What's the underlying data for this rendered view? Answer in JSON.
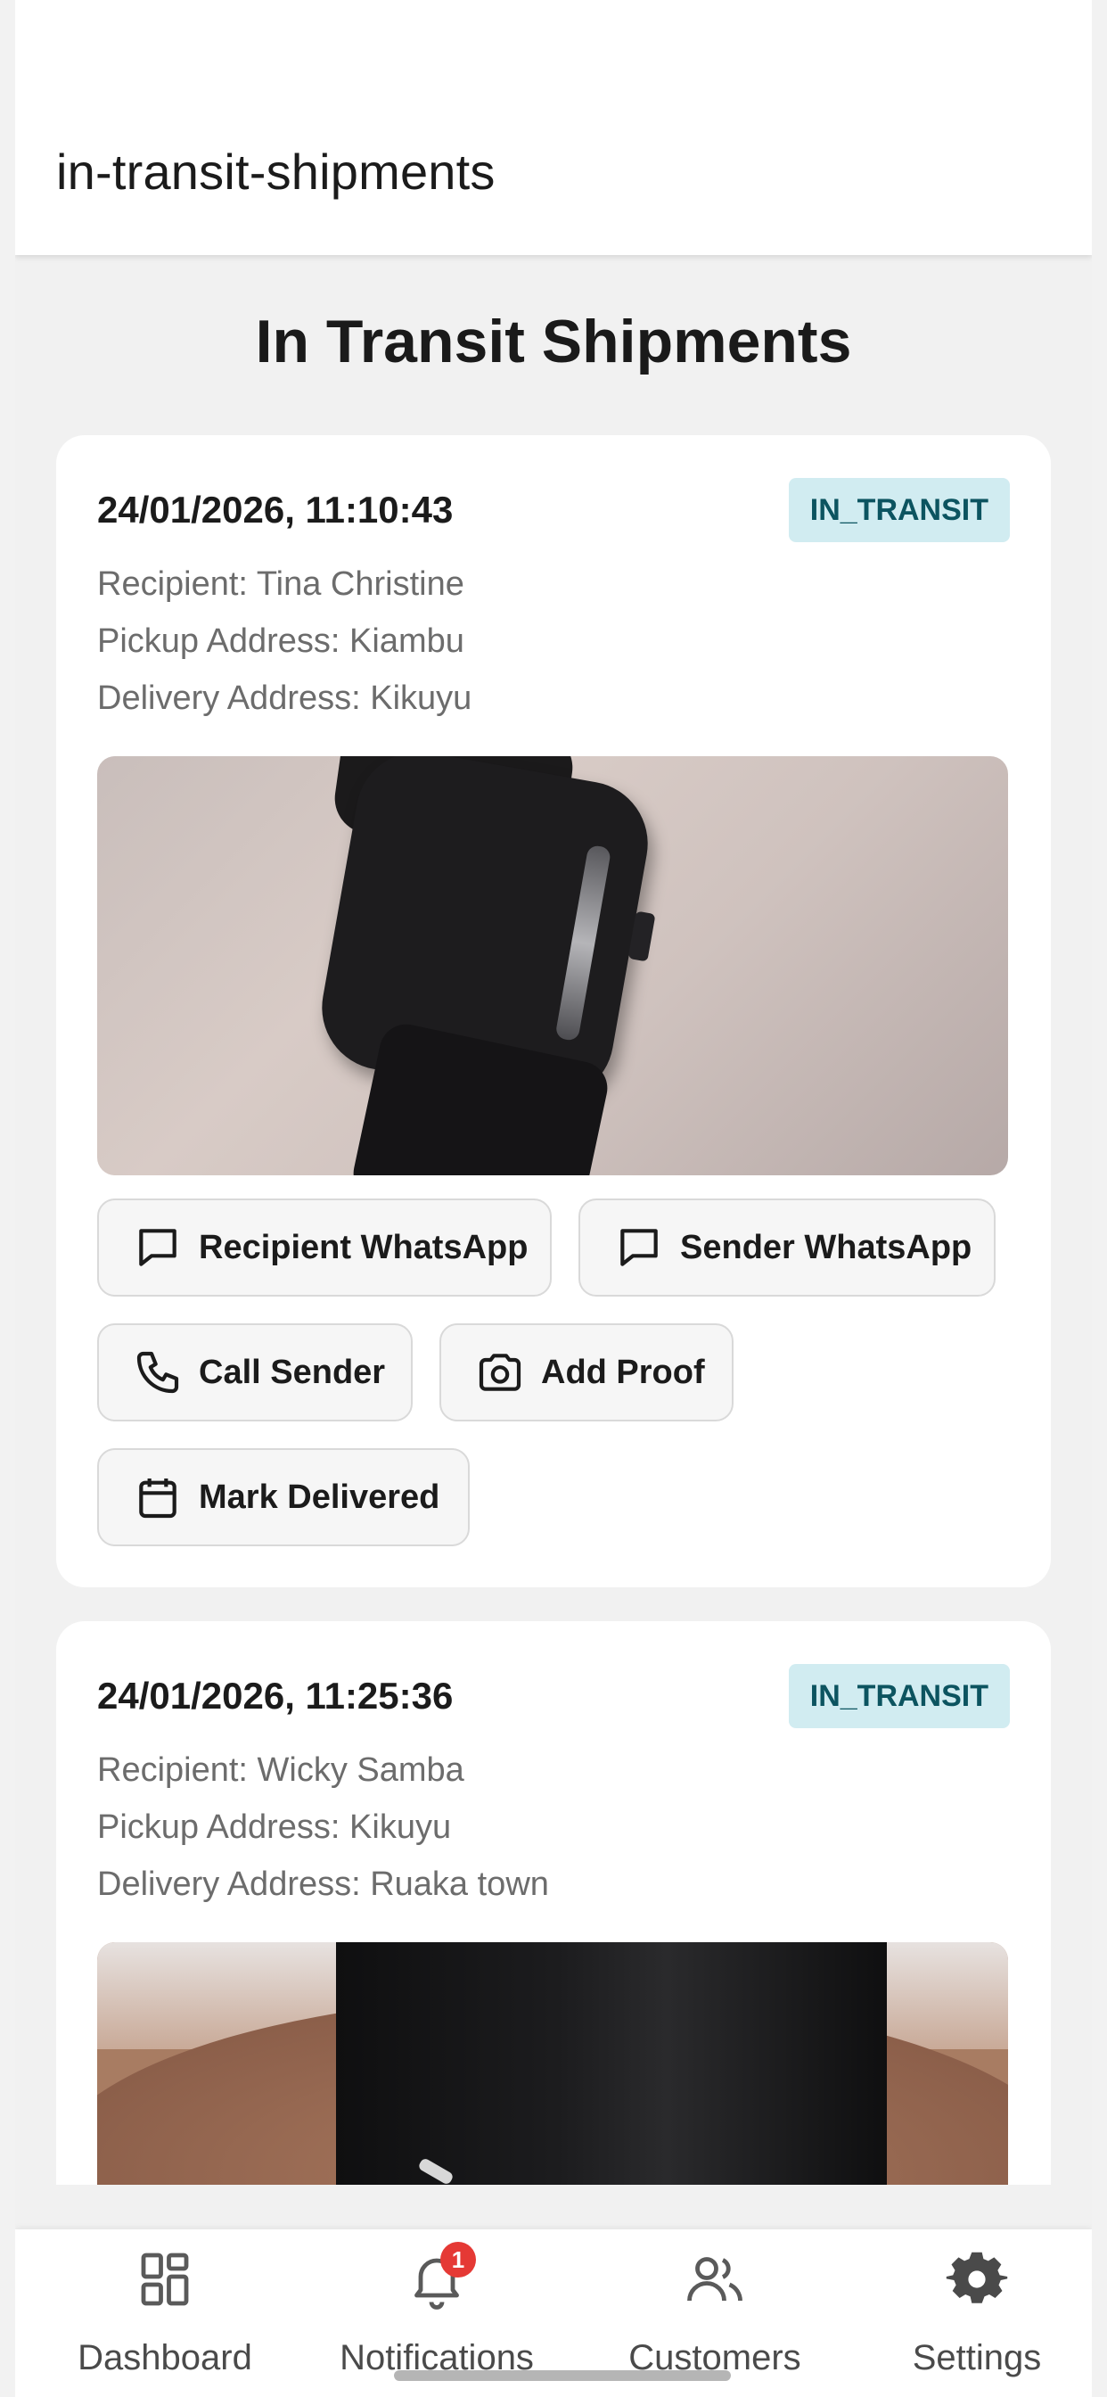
{
  "appbar": {
    "title": "in-transit-shipments"
  },
  "page": {
    "title": "In Transit Shipments"
  },
  "shipments": [
    {
      "datetime": "24/01/2026, 11:10:43",
      "status": "IN_TRANSIT",
      "recipient": "Recipient: Tina Christine",
      "pickup": "Pickup Address: Kiambu",
      "delivery": "Delivery Address: Kikuyu",
      "actions": {
        "recipient_whatsapp": "Recipient WhatsApp",
        "sender_whatsapp": "Sender WhatsApp",
        "call_sender": "Call Sender",
        "add_proof": "Add Proof",
        "mark_delivered": "Mark Delivered"
      }
    },
    {
      "datetime": "24/01/2026, 11:25:36",
      "status": "IN_TRANSIT",
      "recipient": "Recipient: Wicky Samba",
      "pickup": "Pickup Address: Kikuyu",
      "delivery": "Delivery Address: Ruaka town"
    }
  ],
  "bottom_nav": {
    "items": [
      {
        "label": "Dashboard",
        "icon": "grid-icon"
      },
      {
        "label": "Notifications",
        "icon": "bell-icon",
        "badge": "1"
      },
      {
        "label": "Customers",
        "icon": "users-icon"
      },
      {
        "label": "Settings",
        "icon": "gear-icon"
      }
    ]
  },
  "colors": {
    "badge_bg": "#d1ecf1",
    "badge_text": "#0c5460",
    "notification_badge": "#e53935"
  }
}
